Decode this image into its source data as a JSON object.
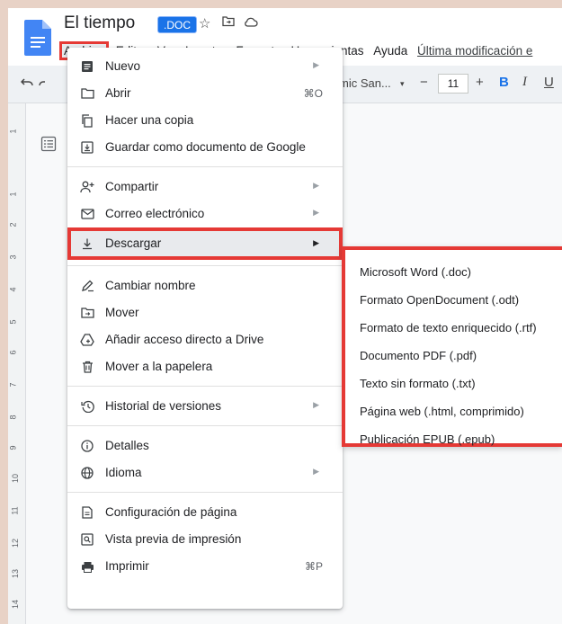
{
  "document": {
    "title": "El tiempo",
    "badge": ".DOC"
  },
  "menubar": {
    "items": [
      "Archivo",
      "Editar",
      "Ver",
      "Insertar",
      "Formato",
      "Herramientas",
      "Ayuda"
    ],
    "last_modified": "Última modificación e"
  },
  "toolbar": {
    "font_name": "mic San...",
    "font_size": "11",
    "minus": "−",
    "plus": "+",
    "bold": "B",
    "italic": "I",
    "underline": "U"
  },
  "ruler": {
    "numbers": [
      "1",
      "1",
      "2",
      "3",
      "4",
      "5",
      "6",
      "7",
      "8",
      "9",
      "10",
      "11",
      "12",
      "13",
      "14"
    ]
  },
  "file_menu": {
    "items": [
      {
        "label": "Nuevo",
        "icon": "new-doc-icon",
        "submenu": true
      },
      {
        "label": "Abrir",
        "icon": "folder-icon",
        "shortcut": "⌘O"
      },
      {
        "label": "Hacer una copia",
        "icon": "copy-icon"
      },
      {
        "label": "Guardar como documento de Google",
        "icon": "save-icon"
      },
      {
        "label": "Compartir",
        "icon": "share-user-icon",
        "submenu": true
      },
      {
        "label": "Correo electrónico",
        "icon": "mail-icon",
        "submenu": true
      },
      {
        "label": "Descargar",
        "icon": "download-icon",
        "submenu": true
      },
      {
        "label": "Cambiar nombre",
        "icon": "rename-icon"
      },
      {
        "label": "Mover",
        "icon": "move-folder-icon"
      },
      {
        "label": "Añadir acceso directo a Drive",
        "icon": "drive-shortcut-icon"
      },
      {
        "label": "Mover a la papelera",
        "icon": "trash-icon"
      },
      {
        "label": "Historial de versiones",
        "icon": "history-icon",
        "submenu": true
      },
      {
        "label": "Detalles",
        "icon": "info-icon"
      },
      {
        "label": "Idioma",
        "icon": "globe-icon",
        "submenu": true
      },
      {
        "label": "Configuración de página",
        "icon": "page-setup-icon"
      },
      {
        "label": "Vista previa de impresión",
        "icon": "print-preview-icon"
      },
      {
        "label": "Imprimir",
        "icon": "printer-icon",
        "shortcut": "⌘P"
      }
    ]
  },
  "download_submenu": {
    "items": [
      "Microsoft Word (.doc)",
      "Formato OpenDocument (.odt)",
      "Formato de texto enriquecido (.rtf)",
      "Documento PDF (.pdf)",
      "Texto sin formato (.txt)",
      "Página web (.html, comprimido)",
      "Publicación EPUB (.epub)"
    ]
  },
  "colors": {
    "highlight_border": "#e53935",
    "docs_blue": "#4285f4",
    "accent": "#1a73e8"
  }
}
